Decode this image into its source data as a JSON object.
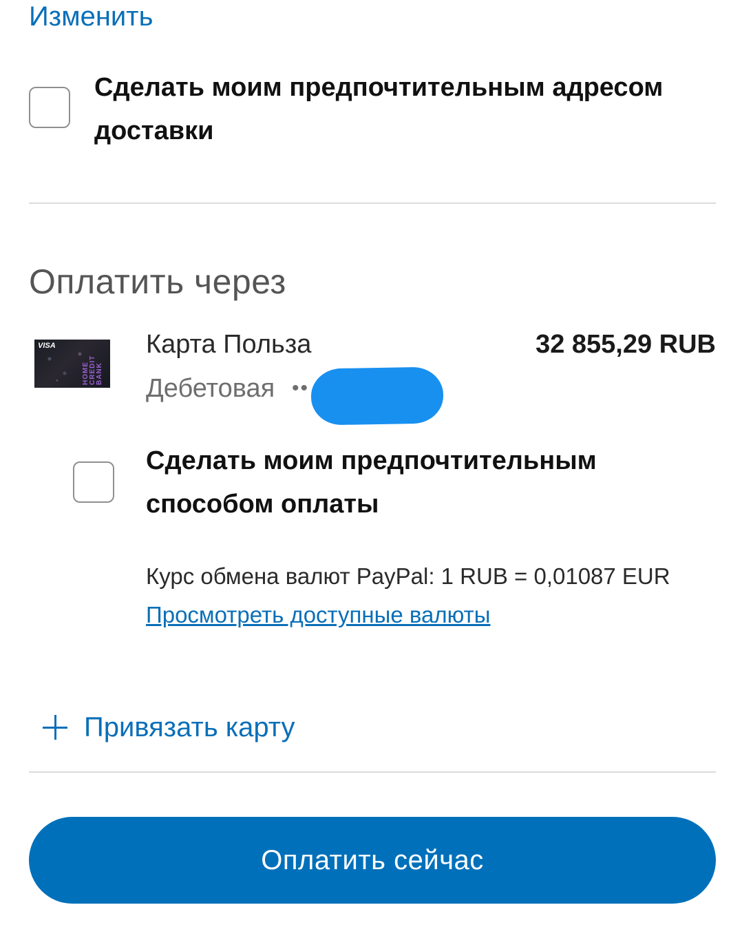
{
  "address": {
    "change_link": "Изменить",
    "preferred_checkbox_label": "Сделать моим предпочтительным адресом доставки",
    "preferred_checked": false
  },
  "payment": {
    "heading": "Оплатить через",
    "card": {
      "thumbnail_text": "VISA",
      "thumbnail_brand": "HOME CREDIT BANK",
      "name": "Карта Польза",
      "balance": "32 855,29 RUB",
      "type": "Дебетовая",
      "masked_number_prefix": "••"
    },
    "preferred_checkbox_label": "Сделать моим предпочтительным способом оплаты",
    "preferred_checked": false,
    "exchange_rate": "Курс обмена валют PayPal: 1 RUB = 0,01087 EUR",
    "currencies_link": "Просмотреть доступные валюты",
    "add_card_label": "Привязать карту"
  },
  "pay_button_label": "Оплатить сейчас",
  "colors": {
    "link": "#0a6fb8",
    "primary_button": "#0070ba",
    "redaction": "#1890f0"
  }
}
